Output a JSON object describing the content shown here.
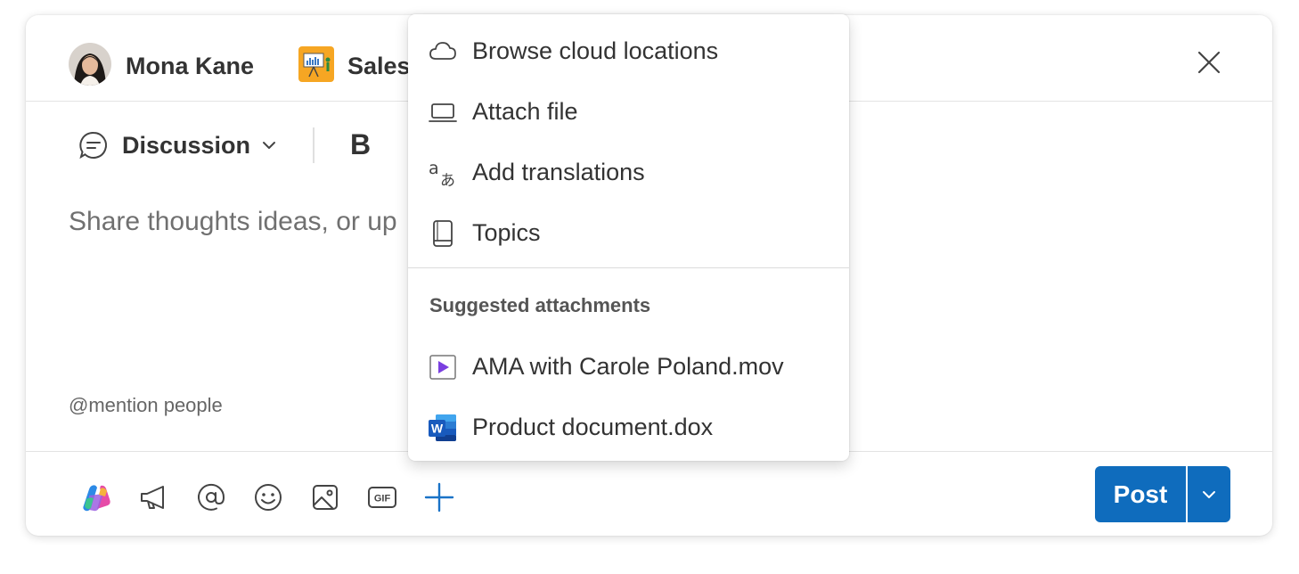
{
  "header": {
    "author_name": "Mona Kane",
    "community_name": "Sales",
    "close_label": "Close"
  },
  "toolbar": {
    "post_type": "Discussion",
    "bold_label": "B"
  },
  "composer": {
    "placeholder": "Share thoughts ideas, or up",
    "mention_hint": "@mention people"
  },
  "footer": {
    "icons": [
      "copilot-icon",
      "megaphone-icon",
      "at-mention-icon",
      "emoji-icon",
      "image-icon",
      "gif-icon",
      "add-icon"
    ],
    "gif_label": "GIF",
    "post_label": "Post"
  },
  "menu": {
    "items": [
      {
        "label": "Browse cloud locations",
        "icon": "cloud-icon"
      },
      {
        "label": "Attach file",
        "icon": "laptop-icon"
      },
      {
        "label": "Add translations",
        "icon": "translate-icon"
      },
      {
        "label": "Topics",
        "icon": "book-icon"
      }
    ],
    "section_title": "Suggested attachments",
    "suggestions": [
      {
        "label": "AMA with Carole Poland.mov",
        "icon": "video-file-icon"
      },
      {
        "label": "Product document.dox",
        "icon": "word-file-icon"
      }
    ]
  },
  "colors": {
    "accent": "#0f6cbd",
    "plus": "#1a73c7",
    "video_purple": "#7a3fe0",
    "word_blue": "#185abd"
  }
}
